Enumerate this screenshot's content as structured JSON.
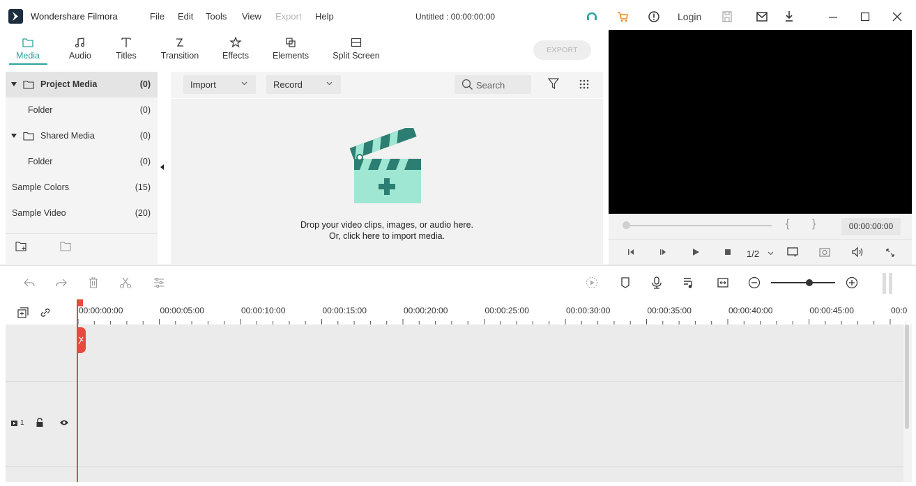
{
  "titlebar": {
    "app_name": "Wondershare Filmora",
    "menu": [
      "File",
      "Edit",
      "Tools",
      "View",
      "Export",
      "Help"
    ],
    "doc_title": "Untitled : 00:00:00:00",
    "login": "Login",
    "icons": [
      "headset-icon",
      "cart-icon",
      "info-icon",
      "save-icon",
      "mail-icon",
      "download-icon",
      "minimize-icon",
      "maximize-icon",
      "close-icon"
    ]
  },
  "tabs": [
    {
      "label": "Media",
      "icon": "folder-icon",
      "active": true
    },
    {
      "label": "Audio",
      "icon": "music-note-icon"
    },
    {
      "label": "Titles",
      "icon": "text-icon"
    },
    {
      "label": "Transition",
      "icon": "transition-icon"
    },
    {
      "label": "Effects",
      "icon": "effects-icon"
    },
    {
      "label": "Elements",
      "icon": "elements-icon"
    },
    {
      "label": "Split Screen",
      "icon": "split-screen-icon"
    }
  ],
  "export_label": "EXPORT",
  "library": {
    "items": [
      {
        "name": "Project Media",
        "count": "(0)"
      },
      {
        "name": "Folder",
        "count": "(0)"
      },
      {
        "name": "Shared Media",
        "count": "(0)"
      },
      {
        "name": "Folder",
        "count": "(0)"
      },
      {
        "name": "Sample Colors",
        "count": "(15)"
      },
      {
        "name": "Sample Video",
        "count": "(20)"
      }
    ]
  },
  "media": {
    "import_label": "Import",
    "record_label": "Record",
    "search_placeholder": "Search",
    "drop_line1": "Drop your video clips, images, or audio here.",
    "drop_line2": "Or, click here to import media."
  },
  "player": {
    "brace_open": "{",
    "brace_close": "}",
    "timecode": "00:00:00:00",
    "quality": "1/2"
  },
  "timeline": {
    "ruler": [
      "00:00:00:00",
      "00:00:05:00",
      "00:00:10:00",
      "00:00:15:00",
      "00:00:20:00",
      "00:00:25:00",
      "00:00:30:00",
      "00:00:35:00",
      "00:00:40:00",
      "00:00:45:00",
      "00:0"
    ],
    "track_label": "1"
  },
  "colors": {
    "accent": "#2ba39c",
    "playhead": "#e84a3b",
    "export_disabled": "#b5b5b5"
  }
}
